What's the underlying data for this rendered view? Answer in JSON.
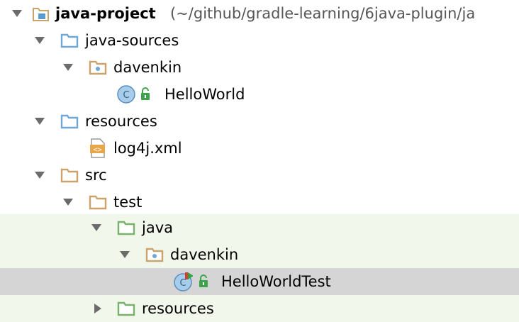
{
  "tree": {
    "rows": [
      {
        "name": "java-project",
        "label": "java-project",
        "extra": "(~/github/gradle-learning/6java-plugin/ja",
        "icon": "module-icon",
        "expanded": true
      },
      {
        "name": "java-sources",
        "label": "java-sources",
        "icon": "source-folder-icon",
        "expanded": true
      },
      {
        "name": "davenkin-main",
        "label": "davenkin",
        "icon": "package-icon",
        "expanded": true
      },
      {
        "name": "helloworld",
        "label": "HelloWorld",
        "icon": "java-class-icon"
      },
      {
        "name": "resources-main",
        "label": "resources",
        "icon": "resources-folder-icon",
        "expanded": true
      },
      {
        "name": "log4j",
        "label": "log4j.xml",
        "icon": "xml-file-icon"
      },
      {
        "name": "src",
        "label": "src",
        "icon": "folder-icon",
        "expanded": true
      },
      {
        "name": "test",
        "label": "test",
        "icon": "folder-icon",
        "expanded": true
      },
      {
        "name": "java-test",
        "label": "java",
        "icon": "test-source-folder-icon",
        "expanded": true
      },
      {
        "name": "davenkin-test",
        "label": "davenkin",
        "icon": "package-icon",
        "expanded": true
      },
      {
        "name": "helloworldtest",
        "label": "HelloWorldTest",
        "icon": "test-class-icon",
        "selected": true
      },
      {
        "name": "resources-test",
        "label": "resources",
        "icon": "test-resources-folder-icon",
        "expanded": false
      }
    ]
  },
  "colors": {
    "tinted_row": "#f1f7ea",
    "selected_row": "#d5d5d5",
    "folder_tan": "#c9a36b",
    "source_blue": "#6fa8d6",
    "test_green": "#78b36b",
    "class_blue": "#a8cdea"
  }
}
